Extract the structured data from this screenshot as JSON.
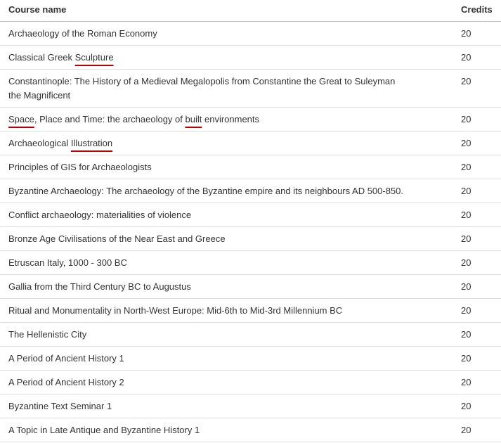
{
  "table": {
    "headers": {
      "name": "Course name",
      "credits": "Credits"
    },
    "rows": [
      {
        "name": "Archaeology of the Roman Economy",
        "credits": "20"
      },
      {
        "name_parts": [
          "Classical Greek ",
          "Sculpture"
        ],
        "credits": "20"
      },
      {
        "name": "Constantinople: The History of a Medieval Megalopolis from Constantine the Great to Suleyman the Magnificent",
        "credits": "20"
      },
      {
        "name_parts": [
          "Space",
          ", Place and Time: the archaeology of ",
          "built",
          " environments"
        ],
        "credits": "20"
      },
      {
        "name_parts": [
          "Archaeological ",
          "Illustration"
        ],
        "credits": "20"
      },
      {
        "name": "Principles of GIS for Archaeologists",
        "credits": "20"
      },
      {
        "name": "Byzantine Archaeology: The archaeology of the Byzantine empire and its neighbours AD 500-850.",
        "credits": "20"
      },
      {
        "name": "Conflict archaeology: materialities of violence",
        "credits": "20"
      },
      {
        "name": "Bronze Age Civilisations of the Near East and Greece",
        "credits": "20"
      },
      {
        "name": "Etruscan Italy, 1000 - 300 BC",
        "credits": "20"
      },
      {
        "name": "Gallia from the Third Century BC to Augustus",
        "credits": "20"
      },
      {
        "name": "Ritual and Monumentality in North-West Europe: Mid-6th to Mid-3rd Millennium BC",
        "credits": "20"
      },
      {
        "name": "The Hellenistic City",
        "credits": "20"
      },
      {
        "name": "A Period of Ancient History 1",
        "credits": "20"
      },
      {
        "name": "A Period of Ancient History 2",
        "credits": "20"
      },
      {
        "name": "Byzantine Text Seminar 1",
        "credits": "20"
      },
      {
        "name": "A Topic in Late Antique and Byzantine History 1",
        "credits": "20"
      }
    ]
  }
}
